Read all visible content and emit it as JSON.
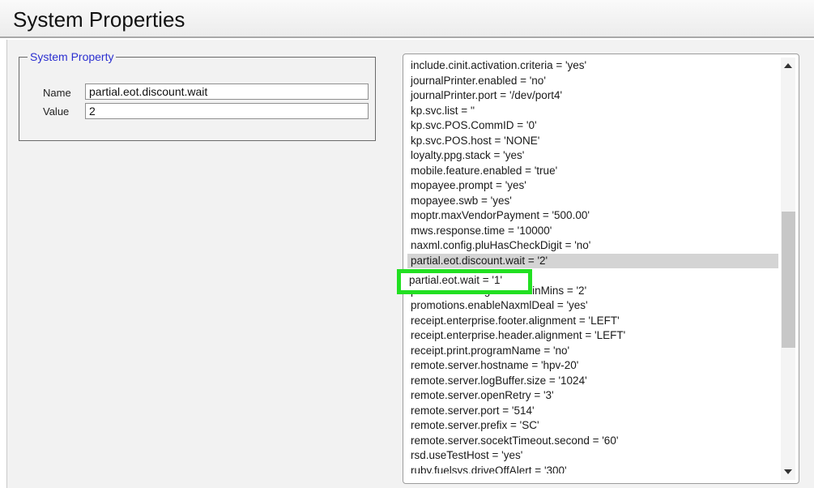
{
  "window": {
    "title": "System Properties"
  },
  "system_property": {
    "legend": "System Property",
    "name_label": "Name",
    "name_value": "partial.eot.discount.wait",
    "value_label": "Value",
    "value_value": "2"
  },
  "property_list": {
    "items": [
      "include.cinit.activation.criteria = 'yes'",
      "journalPrinter.enabled = 'no'",
      "journalPrinter.port = '/dev/port4'",
      "kp.svc.list = ''",
      "kp.svc.POS.CommID = '0'",
      "kp.svc.POS.host = 'NONE'",
      "loyalty.ppg.stack = 'yes'",
      "mobile.feature.enabled = 'true'",
      "mopayee.prompt = 'yes'",
      "mopayee.swb = 'yes'",
      "moptr.maxVendorPayment = '500.00'",
      "mws.response.time = '10000'",
      "naxml.config.pluHasCheckDigit = 'no'",
      "partial.eot.discount.wait = '2'",
      "partial.eot.wait = '1'",
      "pdclose.forcelogout.time.inMins = '2'",
      "promotions.enableNaxmlDeal = 'yes'",
      "receipt.enterprise.footer.alignment = 'LEFT'",
      "receipt.enterprise.header.alignment = 'LEFT'",
      "receipt.print.programName = 'no'",
      "remote.server.hostname = 'hpv-20'",
      "remote.server.logBuffer.size = '1024'",
      "remote.server.openRetry = '3'",
      "remote.server.port = '514'",
      "remote.server.prefix = 'SC'",
      "remote.server.socektTimeout.second = '60'",
      "rsd.useTestHost = 'yes'",
      "ruby.fuelsys.driveOffAlert = '300'"
    ],
    "selected_index": 13,
    "highlighted_item": "partial.eot.wait = '1'"
  },
  "icons": {
    "scroll_up": "chevron-up-icon",
    "scroll_down": "chevron-down-icon"
  },
  "colors": {
    "legend": "#2b2fd0",
    "selection": "#d4d4d4",
    "highlight_border": "#22e022"
  }
}
